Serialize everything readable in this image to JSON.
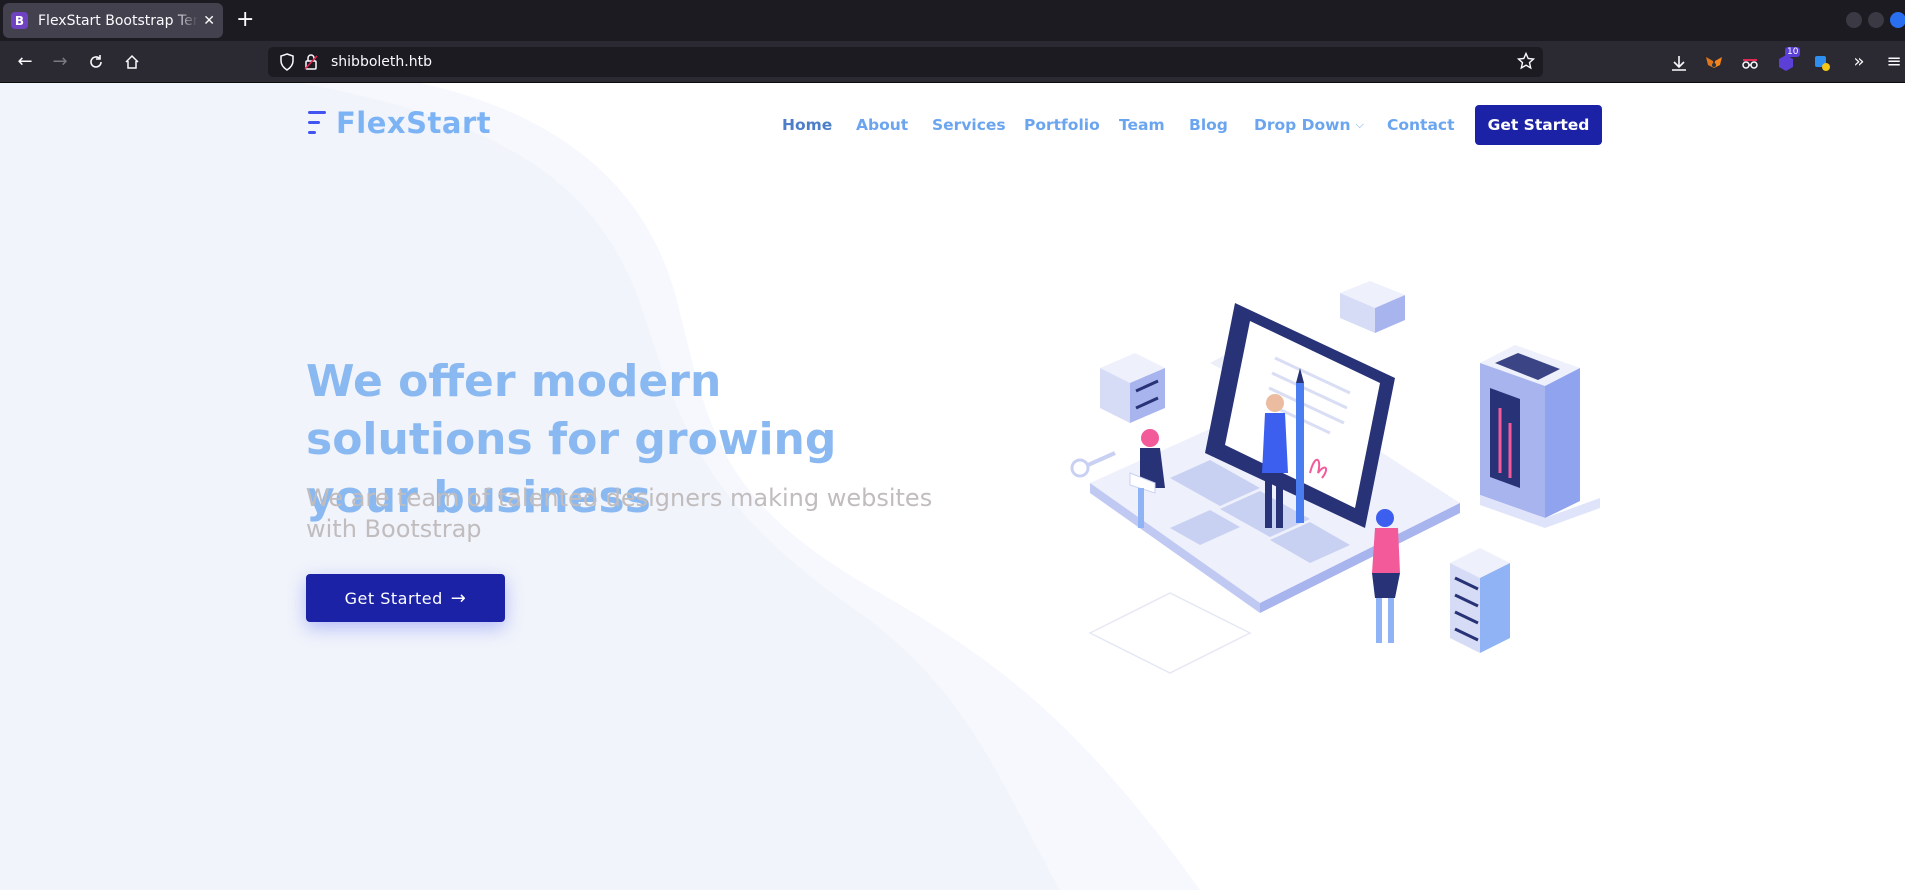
{
  "browser": {
    "tab_title": "FlexStart Bootstrap Template",
    "favicon_letter": "B",
    "url": "shibboleth.htb",
    "extension_badge": "10"
  },
  "site": {
    "logo": "FlexStart",
    "menu": [
      {
        "label": "Home",
        "active": true
      },
      {
        "label": "About"
      },
      {
        "label": "Services"
      },
      {
        "label": "Portfolio"
      },
      {
        "label": "Team"
      },
      {
        "label": "Blog"
      },
      {
        "label": "Drop Down",
        "has_dropdown": true
      },
      {
        "label": "Contact"
      }
    ],
    "header_cta": "Get Started"
  },
  "hero": {
    "title": "We offer modern solutions for growing your business",
    "subtitle": "We are team of talented designers making websites with Bootstrap",
    "cta": "Get Started"
  },
  "colors": {
    "brand": "#1b22a5",
    "title_blue": "#8ab9f1",
    "menu_blue": "#6ba5ef",
    "subtitle_gray": "#c1bcbd"
  }
}
